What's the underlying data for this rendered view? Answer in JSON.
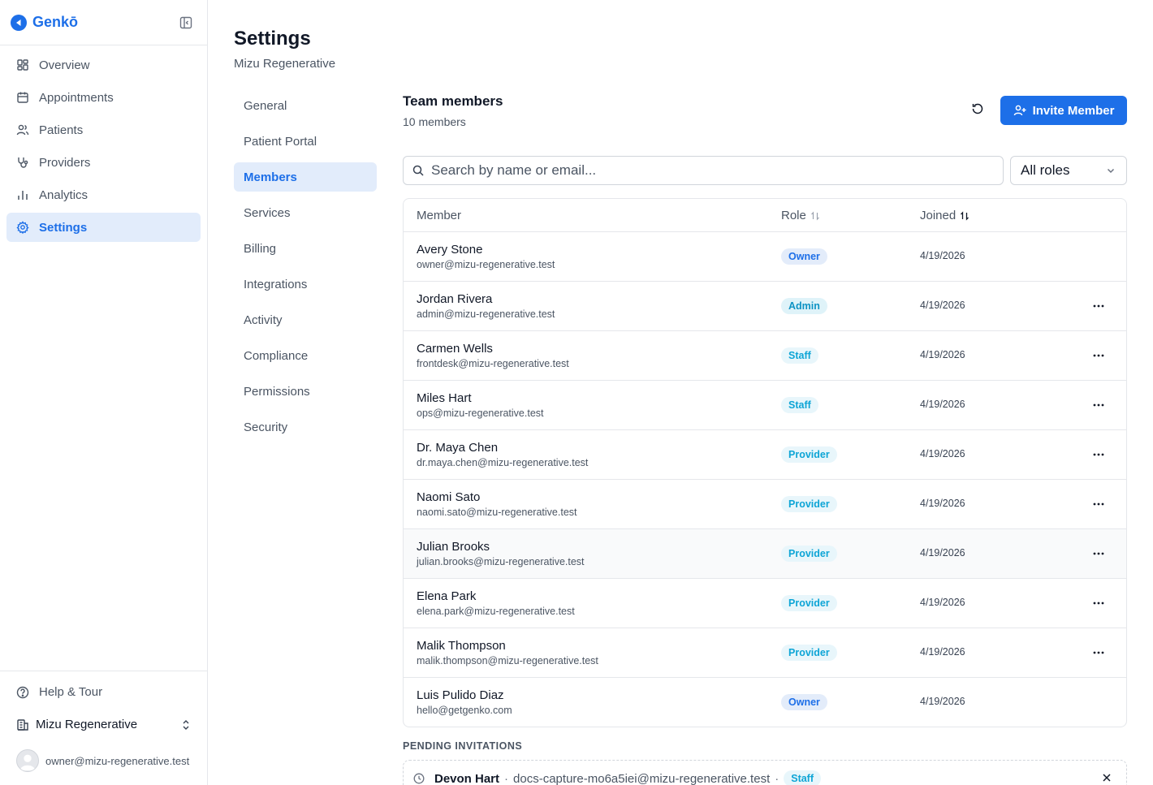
{
  "brand": {
    "name": "Genkō"
  },
  "sidebar": {
    "items": [
      {
        "label": "Overview",
        "icon": "grid-icon"
      },
      {
        "label": "Appointments",
        "icon": "calendar-icon"
      },
      {
        "label": "Patients",
        "icon": "users-icon"
      },
      {
        "label": "Providers",
        "icon": "stethoscope-icon"
      },
      {
        "label": "Analytics",
        "icon": "bar-chart-icon"
      },
      {
        "label": "Settings",
        "icon": "gear-icon",
        "active": true
      }
    ],
    "help_label": "Help & Tour",
    "org_name": "Mizu Regenerative",
    "user_email": "owner@mizu-regenerative.test"
  },
  "page": {
    "title": "Settings",
    "subtitle": "Mizu Regenerative"
  },
  "subnav": {
    "items": [
      {
        "label": "General"
      },
      {
        "label": "Patient Portal"
      },
      {
        "label": "Members",
        "active": true
      },
      {
        "label": "Services"
      },
      {
        "label": "Billing"
      },
      {
        "label": "Integrations"
      },
      {
        "label": "Activity"
      },
      {
        "label": "Compliance"
      },
      {
        "label": "Permissions"
      },
      {
        "label": "Security"
      }
    ]
  },
  "team": {
    "title": "Team members",
    "count_label": "10 members",
    "invite_label": "Invite Member",
    "search_placeholder": "Search by name or email...",
    "role_filter": "All roles"
  },
  "table": {
    "headers": {
      "member": "Member",
      "role": "Role",
      "joined": "Joined"
    },
    "rows": [
      {
        "name": "Avery Stone",
        "email": "owner@mizu-regenerative.test",
        "role": "Owner",
        "joined": "4/19/2026",
        "menu": false
      },
      {
        "name": "Jordan Rivera",
        "email": "admin@mizu-regenerative.test",
        "role": "Admin",
        "joined": "4/19/2026",
        "menu": true
      },
      {
        "name": "Carmen Wells",
        "email": "frontdesk@mizu-regenerative.test",
        "role": "Staff",
        "joined": "4/19/2026",
        "menu": true
      },
      {
        "name": "Miles Hart",
        "email": "ops@mizu-regenerative.test",
        "role": "Staff",
        "joined": "4/19/2026",
        "menu": true
      },
      {
        "name": "Dr. Maya Chen",
        "email": "dr.maya.chen@mizu-regenerative.test",
        "role": "Provider",
        "joined": "4/19/2026",
        "menu": true
      },
      {
        "name": "Naomi Sato",
        "email": "naomi.sato@mizu-regenerative.test",
        "role": "Provider",
        "joined": "4/19/2026",
        "menu": true
      },
      {
        "name": "Julian Brooks",
        "email": "julian.brooks@mizu-regenerative.test",
        "role": "Provider",
        "joined": "4/19/2026",
        "menu": true
      },
      {
        "name": "Elena Park",
        "email": "elena.park@mizu-regenerative.test",
        "role": "Provider",
        "joined": "4/19/2026",
        "menu": true
      },
      {
        "name": "Malik Thompson",
        "email": "malik.thompson@mizu-regenerative.test",
        "role": "Provider",
        "joined": "4/19/2026",
        "menu": true
      },
      {
        "name": "Luis Pulido Diaz",
        "email": "hello@getgenko.com",
        "role": "Owner",
        "joined": "4/19/2026",
        "menu": false
      }
    ]
  },
  "pending": {
    "label": "PENDING INVITATIONS",
    "items": [
      {
        "name": "Devon Hart",
        "email": "docs-capture-mo6a5iei@mizu-regenerative.test",
        "role": "Staff",
        "separator": "·"
      }
    ]
  },
  "colors": {
    "accent": "#1d6fe8",
    "active_bg": "#e2ecfb",
    "border": "#e5e7eb"
  }
}
